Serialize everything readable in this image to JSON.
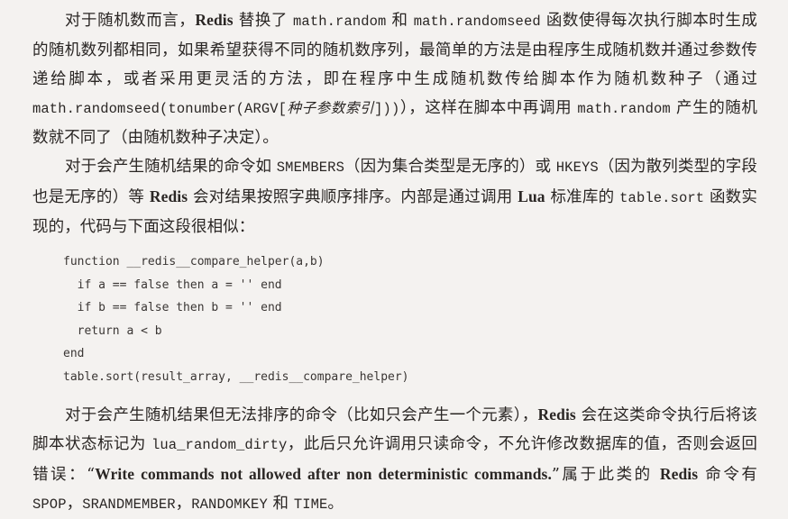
{
  "paragraph1": {
    "t1": "对于随机数而言，",
    "redis1": "Redis",
    "t2": " 替换了 ",
    "c1": "math.random",
    "t3": " 和 ",
    "c2": "math.randomseed",
    "t4": " 函数使得每次执行脚本时生成的随机数列都相同，如果希望获得不同的随机数序列，最简单的方法是由程序生成随机数并通过参数传递给脚本，或者采用更灵活的方法，即在程序中生成随机数传给脚本作为随机数种子（通过 ",
    "c3": "math.randomseed(tonumber(ARGV[",
    "c3_italic": "种子参数索引",
    "c3_end": "]))",
    "t5": "），这样在脚本中再调用 ",
    "c4": "math.random",
    "t6": " 产生的随机数就不同了（由随机数种子决定）。"
  },
  "paragraph2": {
    "t1": "对于会产生随机结果的命令如 ",
    "c1": "SMEMBERS",
    "t2": "（因为集合类型是无序的）或 ",
    "c2": "HKEYS",
    "t3": "（因为散列类型的字段也是无序的）等 ",
    "redis1": "Redis",
    "t4": " 会对结果按照字典顺序排序。内部是通过调用 ",
    "lua": "Lua",
    "t5": " 标准库的 ",
    "c3": "table.sort",
    "t6": " 函数实现的，代码与下面这段很相似："
  },
  "code": {
    "lines": [
      "function __redis__compare_helper(a,b)",
      "  if a == false then a = '' end",
      "  if b == false then b = '' end",
      "  return a < b",
      "end",
      "table.sort(result_array, __redis__compare_helper)"
    ]
  },
  "paragraph3": {
    "t1": "对于会产生随机结果但无法排序的命令（比如只会产生一个元素），",
    "redis1": "Redis",
    "t2": " 会在这类命令执行后将该脚本状态标记为 ",
    "c1": "lua_random_dirty",
    "t3": "，此后只允许调用只读命令，不允许修改数据库的值，否则会返回错误：“",
    "quote": "Write commands not allowed after non deterministic commands.",
    "t4": "”属于此类的 ",
    "redis2": "Redis",
    "t5": " 命令有 ",
    "c2": "SPOP",
    "t6": "，",
    "c3": "SRANDMEMBER",
    "t7": "，",
    "c4": "RANDOMKEY",
    "t8": " 和 ",
    "c5": "TIME",
    "t9": "。"
  }
}
